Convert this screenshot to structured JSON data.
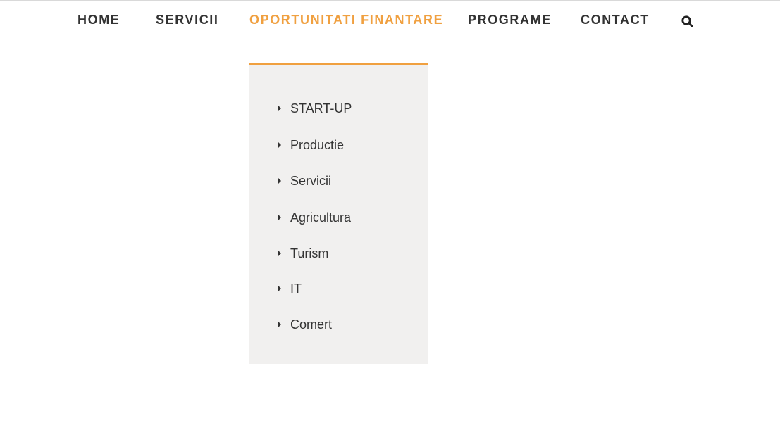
{
  "nav": {
    "items": [
      {
        "label": "HOME"
      },
      {
        "label": "SERVICII"
      },
      {
        "label": "OPORTUNITATI FINANTARE",
        "active": true
      },
      {
        "label": "PROGRAME"
      },
      {
        "label": "CONTACT"
      }
    ],
    "search_icon": "search-icon"
  },
  "dropdown": {
    "items": [
      {
        "label": "START-UP"
      },
      {
        "label": "Productie"
      },
      {
        "label": "Servicii"
      },
      {
        "label": "Agricultura"
      },
      {
        "label": "Turism"
      },
      {
        "label": "IT"
      },
      {
        "label": "Comert"
      }
    ]
  },
  "colors": {
    "accent": "#f0a040",
    "text": "#333333",
    "dropdown_bg": "#f1f0ef"
  }
}
